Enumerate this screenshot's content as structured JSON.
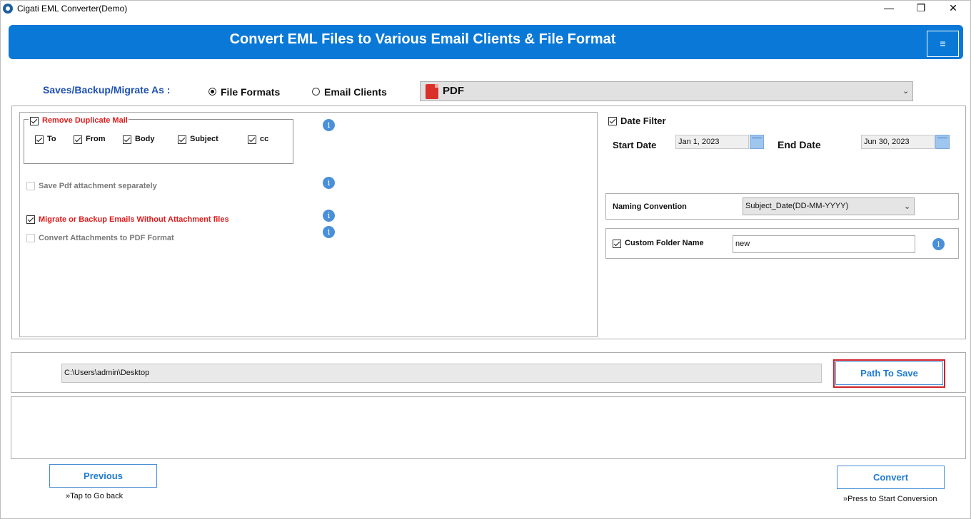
{
  "window": {
    "title": "Cigati EML Converter(Demo)",
    "controls": {
      "minimize": "—",
      "restore": "❐",
      "close": "✕"
    }
  },
  "banner": {
    "title": "Convert EML Files to Various Email Clients & File Format",
    "menu_icon": "≡"
  },
  "saves": {
    "label": "Saves/Backup/Migrate As :",
    "options": [
      {
        "label": "File Formats",
        "selected": true
      },
      {
        "label": "Email Clients",
        "selected": false
      }
    ],
    "format": {
      "value": "PDF",
      "icon": "pdf-icon"
    }
  },
  "duplicate": {
    "label": "Remove Duplicate Mail",
    "checked": true,
    "fields": [
      {
        "label": "To",
        "checked": true
      },
      {
        "label": "From",
        "checked": true
      },
      {
        "label": "Body",
        "checked": true
      },
      {
        "label": "Subject",
        "checked": true
      },
      {
        "label": "cc",
        "checked": true
      }
    ]
  },
  "options": {
    "save_pdf_attachment": {
      "label": "Save Pdf attachment separately",
      "checked": false,
      "enabled": false
    },
    "without_attachment": {
      "label": "Migrate or Backup Emails Without Attachment files",
      "checked": true,
      "enabled": true
    },
    "convert_attachments": {
      "label": "Convert Attachments to PDF Format",
      "checked": false,
      "enabled": false
    }
  },
  "date_filter": {
    "label": "Date Filter",
    "checked": true,
    "start_label": "Start Date",
    "start_value": "Jan 1, 2023",
    "end_label": "End Date",
    "end_value": "Jun 30, 2023"
  },
  "naming": {
    "label": "Naming Convention",
    "value": "Subject_Date(DD-MM-YYYY)"
  },
  "custom_folder": {
    "label": "Custom Folder Name",
    "checked": true,
    "value": "new"
  },
  "path": {
    "value": "C:\\Users\\admin\\Desktop",
    "button": "Path To Save"
  },
  "footer": {
    "previous_label": "Previous",
    "previous_hint": "»Tap to Go back",
    "convert_label": "Convert",
    "convert_hint": "»Press to Start Conversion"
  },
  "colors": {
    "banner": "#0a78d6",
    "accent_text": "#1e50b4",
    "warning_text": "#e01a1a",
    "highlight_outline": "#d0212a"
  }
}
